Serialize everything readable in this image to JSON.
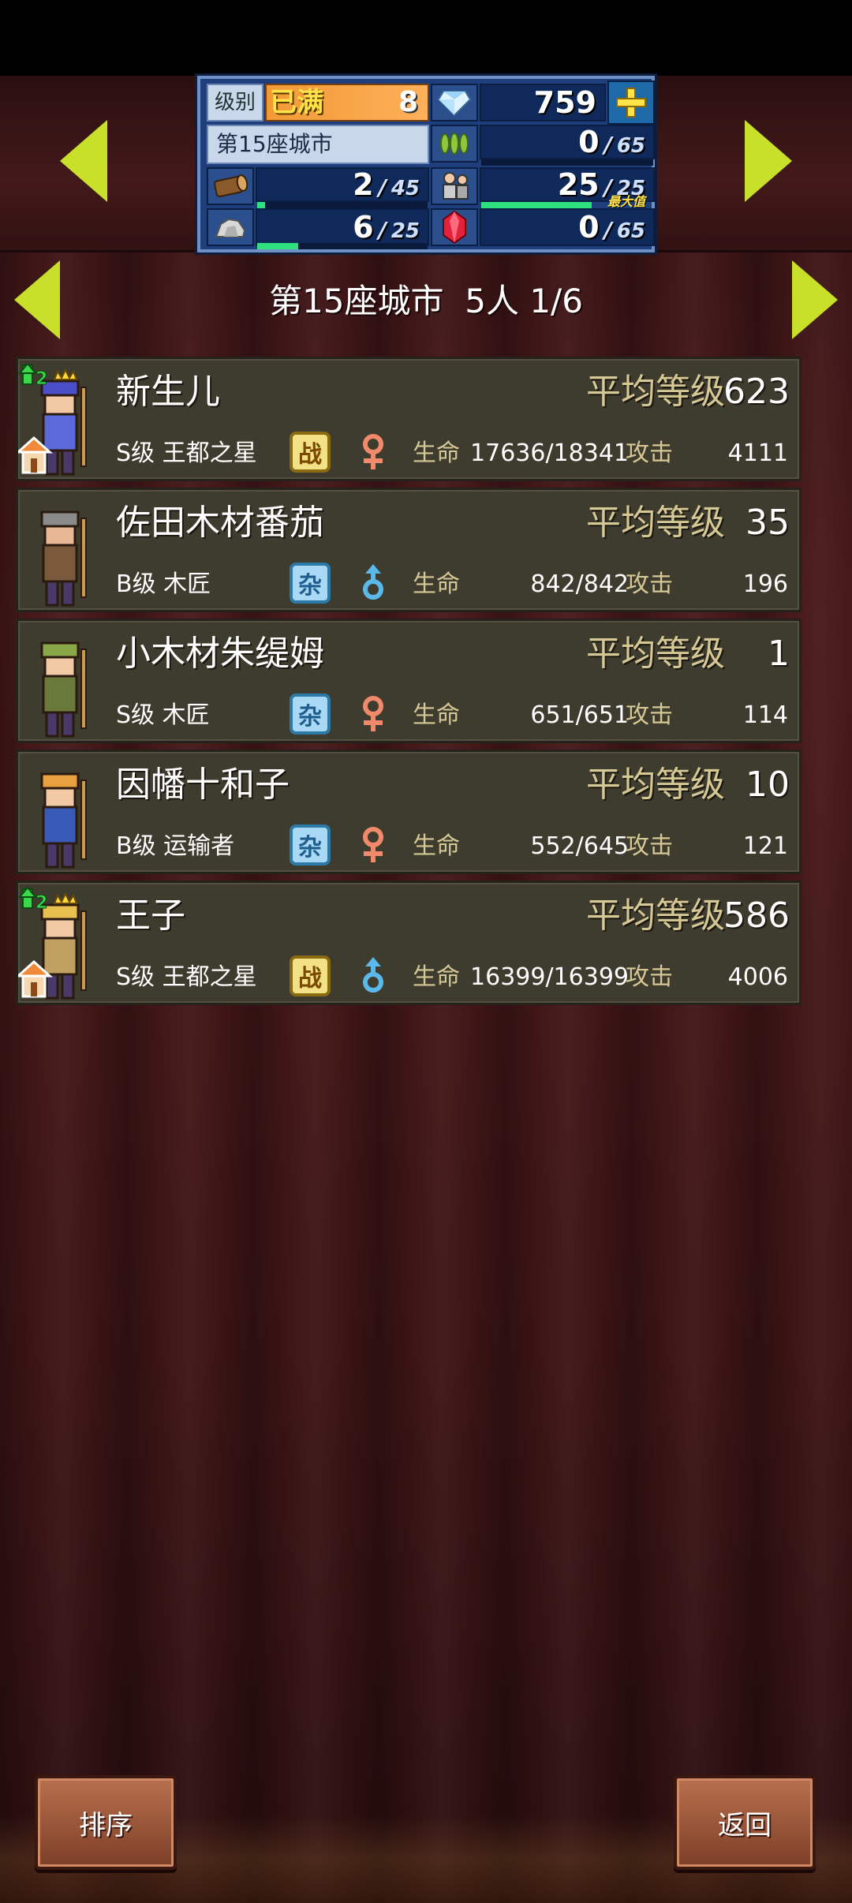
{
  "resources": {
    "level_label": "级别",
    "level_max_text": "已满",
    "level_value": "8",
    "gems": "759",
    "city_name": "第15座城市",
    "wood": {
      "current": "2",
      "max": "45",
      "fill": 0.044
    },
    "food": {
      "current": "0",
      "max": "65",
      "fill": 0.0
    },
    "population": {
      "current": "25",
      "max": "25",
      "fill": 1.0,
      "max_tag": "最大值"
    },
    "stone": {
      "current": "6",
      "max": "25",
      "fill": 0.24
    },
    "ruby": {
      "current": "0",
      "max": "65",
      "fill": 0.0
    }
  },
  "title": {
    "city": "第15座城市",
    "people": "5人",
    "page": "1/6"
  },
  "labels": {
    "avg_level": "平均等级",
    "hp": "生命",
    "attack": "攻击"
  },
  "residents": [
    {
      "name": "新生儿",
      "avg_level": "623",
      "rank_job": "S级 王都之星",
      "badge": "战",
      "badge_type": "battle",
      "gender": "female",
      "hp": "17636/18341",
      "attack": "4111",
      "promote_count": "2",
      "has_house": true
    },
    {
      "name": "佐田木材番茄",
      "avg_level": "35",
      "rank_job": "B级 木匠",
      "badge": "杂",
      "badge_type": "misc",
      "gender": "male",
      "hp": "842/842",
      "attack": "196",
      "promote_count": "",
      "has_house": false
    },
    {
      "name": "小木材朱缇姆",
      "avg_level": "1",
      "rank_job": "S级 木匠",
      "badge": "杂",
      "badge_type": "misc",
      "gender": "female",
      "hp": "651/651",
      "attack": "114",
      "promote_count": "",
      "has_house": false
    },
    {
      "name": "因幡十和子",
      "avg_level": "10",
      "rank_job": "B级 运输者",
      "badge": "杂",
      "badge_type": "misc",
      "gender": "female",
      "hp": "552/645",
      "attack": "121",
      "promote_count": "",
      "has_house": false
    },
    {
      "name": "王子",
      "avg_level": "586",
      "rank_job": "S级 王都之星",
      "badge": "战",
      "badge_type": "battle",
      "gender": "male",
      "hp": "16399/16399",
      "attack": "4006",
      "promote_count": "2",
      "has_house": true
    }
  ],
  "buttons": {
    "sort": "排序",
    "back": "返回"
  },
  "colors": {
    "accent_arrow": "#c8e02a",
    "label_gold": "#d6c894",
    "female": "#f08a6a",
    "male": "#5ab8ea"
  }
}
